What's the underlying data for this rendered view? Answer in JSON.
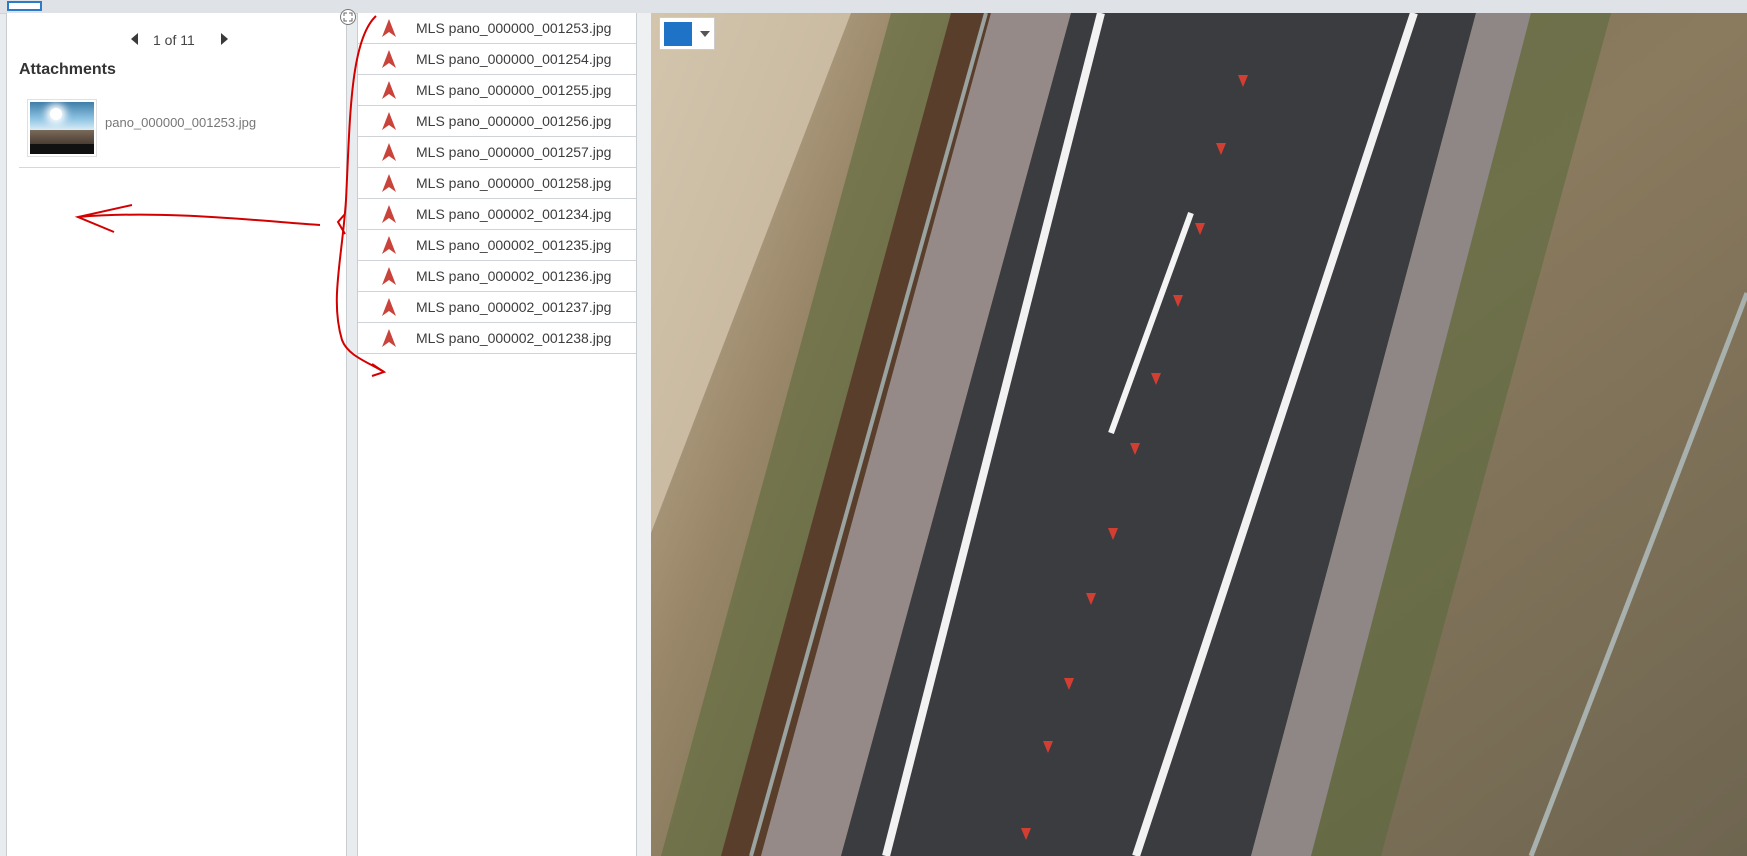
{
  "popup": {
    "pager_text": "1 of 11",
    "attachments_title": "Attachments",
    "attachment": {
      "name": "pano_000000_001253.jpg"
    }
  },
  "feature_list": {
    "items": [
      "MLS pano_000000_001253.jpg",
      "MLS pano_000000_001254.jpg",
      "MLS pano_000000_001255.jpg",
      "MLS pano_000000_001256.jpg",
      "MLS pano_000000_001257.jpg",
      "MLS pano_000000_001258.jpg",
      "MLS pano_000002_001234.jpg",
      "MLS pano_000002_001235.jpg",
      "MLS pano_000002_001236.jpg",
      "MLS pano_000002_001237.jpg",
      "MLS pano_000002_001238.jpg"
    ],
    "icon": "red-direction-arrow-icon"
  },
  "map": {
    "basemap_button_icon": "basemap-gallery-icon"
  },
  "colors": {
    "accent": "#2b7bc6",
    "annotation": "#d40000",
    "feature_marker": "#c9433a"
  }
}
